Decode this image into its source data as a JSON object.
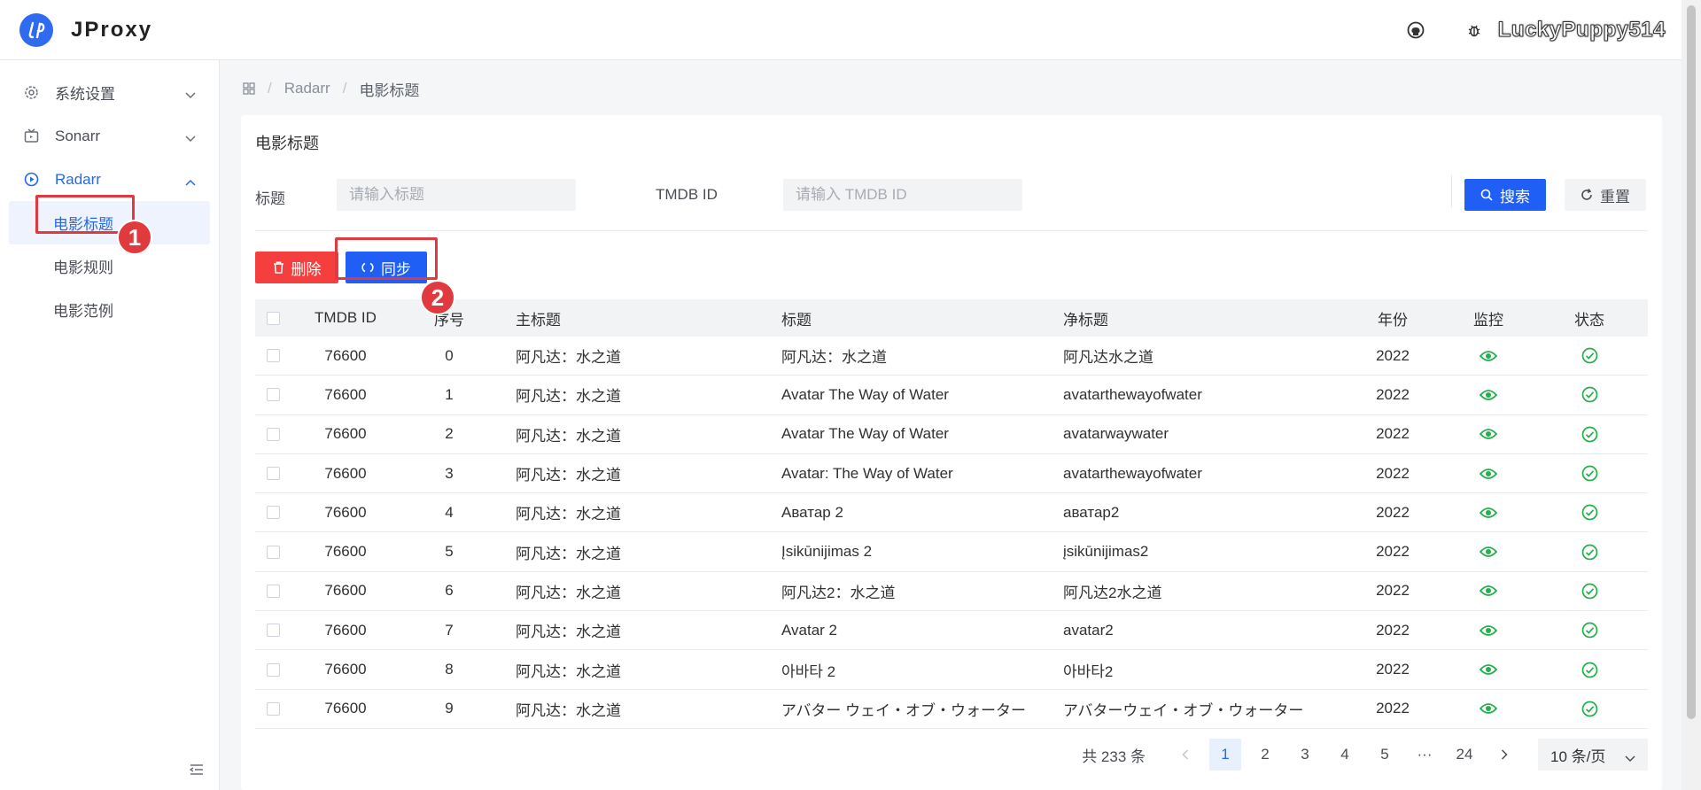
{
  "app": {
    "title": "JProxy",
    "username": "LuckyPuppy514"
  },
  "sidebar": {
    "items": [
      {
        "label": "系统设置",
        "icon": "gear-icon"
      },
      {
        "label": "Sonarr",
        "icon": "tv-icon"
      },
      {
        "label": "Radarr",
        "icon": "play-circle-icon"
      }
    ],
    "radarr_children": [
      {
        "label": "电影标题"
      },
      {
        "label": "电影规则"
      },
      {
        "label": "电影范例"
      }
    ]
  },
  "annotations": {
    "one": "1",
    "two": "2"
  },
  "breadcrumb": {
    "parent": "Radarr",
    "current": "电影标题",
    "separator": "/"
  },
  "card": {
    "title": "电影标题"
  },
  "filters": {
    "title_label": "标题",
    "title_placeholder": "请输入标题",
    "tmdb_label": "TMDB ID",
    "tmdb_placeholder": "请输入 TMDB ID",
    "search_label": "搜索",
    "reset_label": "重置"
  },
  "toolbar": {
    "delete_label": "删除",
    "sync_label": "同步"
  },
  "table": {
    "headers": {
      "tmdb_id": "TMDB ID",
      "seq": "序号",
      "main_title": "主标题",
      "title": "标题",
      "clean_title": "净标题",
      "year": "年份",
      "monitor": "监控",
      "status": "状态"
    },
    "rows": [
      {
        "tmdb_id": "76600",
        "seq": "0",
        "main_title": "阿凡达：水之道",
        "title": "阿凡达：水之道",
        "clean_title": "阿凡达水之道",
        "year": "2022"
      },
      {
        "tmdb_id": "76600",
        "seq": "1",
        "main_title": "阿凡达：水之道",
        "title": "Avatar The Way of Water",
        "clean_title": "avatarthewayofwater",
        "year": "2022"
      },
      {
        "tmdb_id": "76600",
        "seq": "2",
        "main_title": "阿凡达：水之道",
        "title": "Avatar The Way of Water",
        "clean_title": "avatarwaywater",
        "year": "2022"
      },
      {
        "tmdb_id": "76600",
        "seq": "3",
        "main_title": "阿凡达：水之道",
        "title": "Avatar: The Way of Water",
        "clean_title": "avatarthewayofwater",
        "year": "2022"
      },
      {
        "tmdb_id": "76600",
        "seq": "4",
        "main_title": "阿凡达：水之道",
        "title": "Аватар 2",
        "clean_title": "аватар2",
        "year": "2022"
      },
      {
        "tmdb_id": "76600",
        "seq": "5",
        "main_title": "阿凡达：水之道",
        "title": "Įsikūnijimas 2",
        "clean_title": "įsikūnijimas2",
        "year": "2022"
      },
      {
        "tmdb_id": "76600",
        "seq": "6",
        "main_title": "阿凡达：水之道",
        "title": "阿凡达2：水之道",
        "clean_title": "阿凡达2水之道",
        "year": "2022"
      },
      {
        "tmdb_id": "76600",
        "seq": "7",
        "main_title": "阿凡达：水之道",
        "title": "Avatar 2",
        "clean_title": "avatar2",
        "year": "2022"
      },
      {
        "tmdb_id": "76600",
        "seq": "8",
        "main_title": "阿凡达：水之道",
        "title": "아바타 2",
        "clean_title": "아바타2",
        "year": "2022"
      },
      {
        "tmdb_id": "76600",
        "seq": "9",
        "main_title": "阿凡达：水之道",
        "title": "アバター ウェイ・オブ・ウォーター",
        "clean_title": "アバターウェイ・オブ・ウォーター",
        "year": "2022"
      }
    ]
  },
  "pagination": {
    "total_text": "共 233 条",
    "pages": [
      "1",
      "2",
      "3",
      "4",
      "5",
      "···",
      "24"
    ],
    "current": "1",
    "page_size": "10 条/页"
  },
  "colors": {
    "primary": "#1f5ff5",
    "danger": "#f53f3f",
    "success": "#23b04a",
    "annotation": "#e0393e"
  }
}
